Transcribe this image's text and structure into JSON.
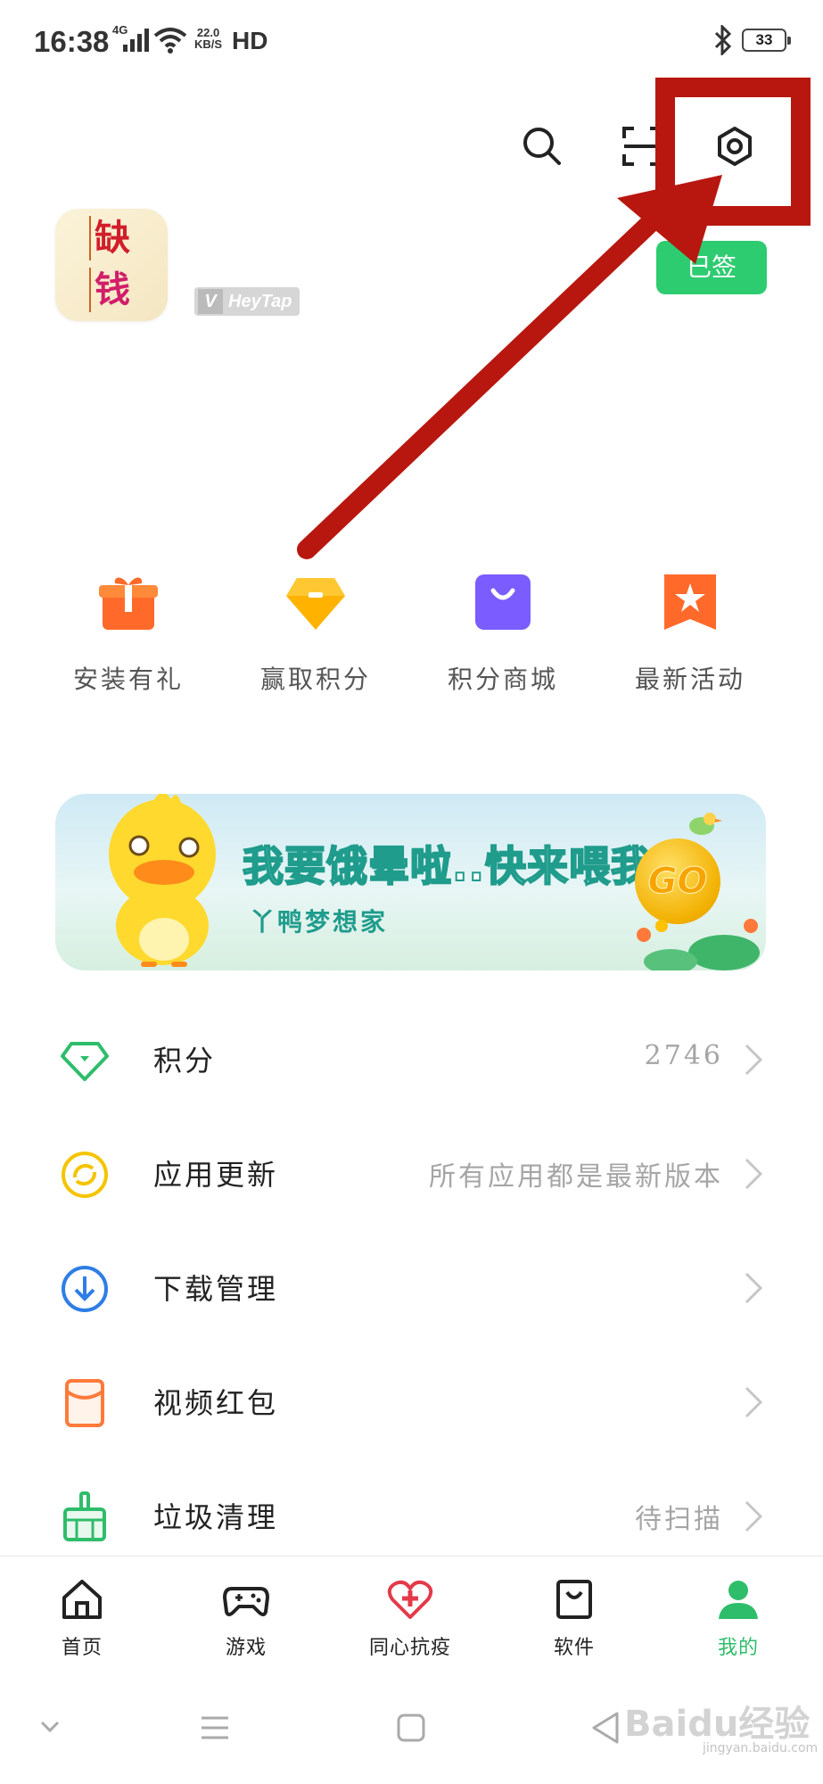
{
  "status_bar": {
    "time": "16:38",
    "network": "4G",
    "speed_value": "22.0",
    "speed_unit": "KB/S",
    "hd": "HD",
    "battery": "33"
  },
  "profile": {
    "avatar_char_1": "缺",
    "avatar_char_2": "钱",
    "heytap_label": "HeyTap",
    "checkin_label": "已签"
  },
  "quick_actions": [
    {
      "label": "安装有礼",
      "icon": "gift-icon",
      "color": "#ff6a2a"
    },
    {
      "label": "赢取积分",
      "icon": "diamond-icon",
      "color": "#ffb300"
    },
    {
      "label": "积分商城",
      "icon": "shopping-bag-icon",
      "color": "#7a5cff"
    },
    {
      "label": "最新活动",
      "icon": "star-ribbon-icon",
      "color": "#ff6a2a"
    }
  ],
  "banner": {
    "title": "我要饿晕啦..快来喂我!",
    "subtitle": "丫鸭梦想家",
    "coin": "GO"
  },
  "list": [
    {
      "label": "积分",
      "value": "2746",
      "icon": "diamond-outline-icon",
      "color": "#2ebd6a"
    },
    {
      "label": "应用更新",
      "value": "所有应用都是最新版本",
      "icon": "refresh-icon",
      "color": "#f5c400"
    },
    {
      "label": "下载管理",
      "value": "",
      "icon": "download-icon",
      "color": "#2f7de6"
    },
    {
      "label": "视频红包",
      "value": "",
      "icon": "red-packet-icon",
      "color": "#ff7a3a"
    },
    {
      "label": "垃圾清理",
      "value": "待扫描",
      "icon": "broom-icon",
      "color": "#2ebd6a"
    }
  ],
  "bottom_nav": [
    {
      "label": "首页",
      "icon": "home-icon"
    },
    {
      "label": "游戏",
      "icon": "gamepad-icon"
    },
    {
      "label": "同心抗疫",
      "icon": "heart-plus-icon"
    },
    {
      "label": "软件",
      "icon": "bag-icon"
    },
    {
      "label": "我的",
      "icon": "person-icon",
      "active": true
    }
  ],
  "watermark": {
    "brand": "Baidu经验",
    "url": "jingyan.baidu.com"
  },
  "colors": {
    "accent": "#2ebd6a",
    "annotation_red": "#b8170f"
  }
}
